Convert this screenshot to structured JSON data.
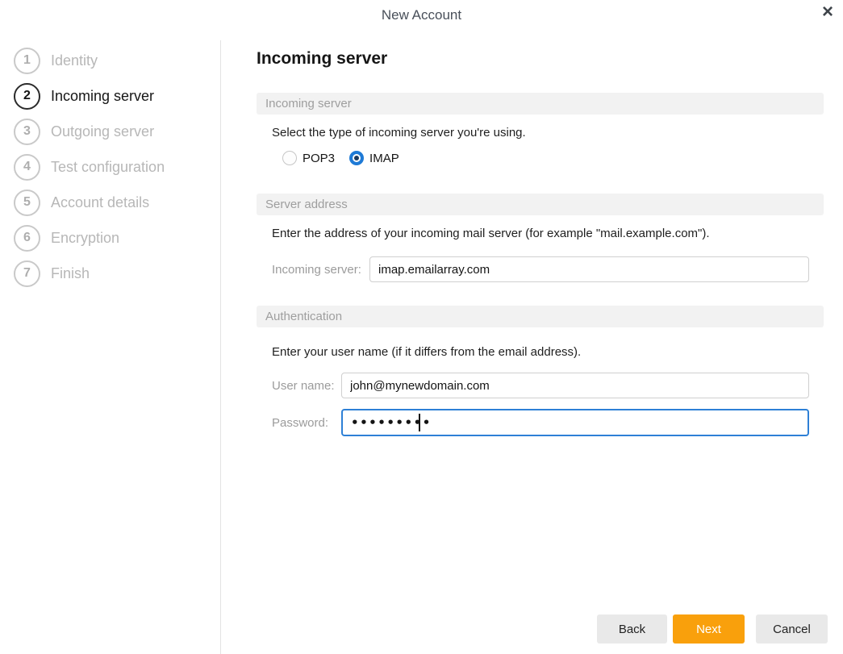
{
  "window": {
    "title": "New Account",
    "close_glyph": "×"
  },
  "colors": {
    "accent_orange": "#f9a00c",
    "radio_selected_blue": "#1e7ad6",
    "focused_input_border": "#2e80d6",
    "section_header_bg": "#f2f2f2",
    "inactive_step_gray": "#b7b7b7"
  },
  "sidebar": {
    "steps": [
      {
        "num": "1",
        "label": "Identity",
        "active": false
      },
      {
        "num": "2",
        "label": "Incoming server",
        "active": true
      },
      {
        "num": "3",
        "label": "Outgoing server",
        "active": false
      },
      {
        "num": "4",
        "label": "Test configuration",
        "active": false
      },
      {
        "num": "5",
        "label": "Account details",
        "active": false
      },
      {
        "num": "6",
        "label": "Encryption",
        "active": false
      },
      {
        "num": "7",
        "label": "Finish",
        "active": false
      }
    ]
  },
  "main": {
    "heading": "Incoming server",
    "server_type": {
      "header": "Incoming server",
      "description": "Select the type of incoming server you're using.",
      "options": [
        {
          "label": "POP3",
          "selected": false
        },
        {
          "label": "IMAP",
          "selected": true
        }
      ]
    },
    "server_address": {
      "header": "Server address",
      "description": "Enter the address of your incoming mail server (for example \"mail.example.com\").",
      "field_label": "Incoming server:",
      "field_value": "imap.emailarray.com"
    },
    "authentication": {
      "header": "Authentication",
      "description": "Enter your user name (if it differs from the email address).",
      "username_label": "User name:",
      "username_value": "john@mynewdomain.com",
      "password_label": "Password:",
      "password_value": "•••••••••"
    }
  },
  "footer": {
    "back_label": "Back",
    "next_label": "Next",
    "cancel_label": "Cancel"
  }
}
